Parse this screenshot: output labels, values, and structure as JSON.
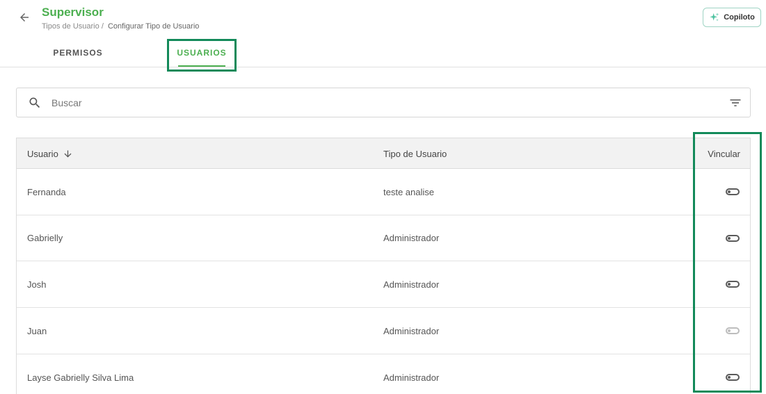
{
  "header": {
    "title": "Supervisor",
    "breadcrumb": [
      "Tipos de Usuario",
      "Configurar Tipo de Usuario"
    ],
    "breadcrumb_separator": "/",
    "copilot_label": "Copiloto"
  },
  "tabs": [
    {
      "label": "PERMISOS",
      "active": false
    },
    {
      "label": "USUARIOS",
      "active": true
    }
  ],
  "search": {
    "placeholder": "Buscar",
    "value": ""
  },
  "table": {
    "columns": [
      "Usuario",
      "Tipo de Usuario",
      "Vincular"
    ],
    "sort_column": "Usuario",
    "sort_direction": "descending",
    "rows": [
      {
        "name": "Fernanda",
        "type": "teste analise",
        "linked": false,
        "disabled": false
      },
      {
        "name": "Gabrielly",
        "type": "Administrador",
        "linked": false,
        "disabled": false
      },
      {
        "name": "Josh",
        "type": "Administrador",
        "linked": false,
        "disabled": false
      },
      {
        "name": "Juan",
        "type": "Administrador",
        "linked": false,
        "disabled": true
      },
      {
        "name": "Layse Gabrielly Silva Lima",
        "type": "Administrador",
        "linked": false,
        "disabled": false
      }
    ]
  },
  "colors": {
    "accent": "#4caf50",
    "highlight_border": "#138a5a",
    "copilot_border": "#9fd4c4"
  },
  "icons": {
    "back": "arrow-left-icon",
    "copilot": "sparkle-icon",
    "search": "search-icon",
    "filter": "filter-icon",
    "sort": "arrow-down-icon",
    "toggle": "toggle-switch-icon"
  }
}
